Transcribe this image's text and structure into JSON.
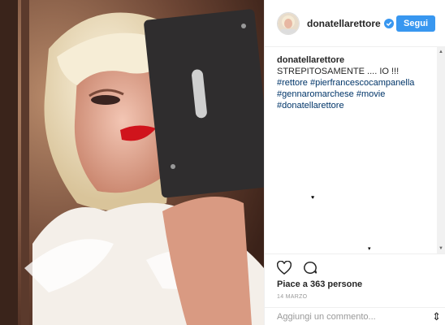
{
  "header": {
    "username": "donatellarettore",
    "follow_label": "Segui"
  },
  "caption": {
    "username": "donatellarettore",
    "text": " STREPITOSAMENTE .... IO !!! ",
    "hashtags": [
      "#rettore",
      "#pierfrancescocampanella",
      "#gennaromarchese",
      "#movie",
      "#donatellarettore"
    ]
  },
  "likes": "Piace a 363 persone",
  "date": "14 MARZO",
  "comment_box": {
    "placeholder": "Aggiungi un commento..."
  },
  "icons": {
    "like": "heart-icon",
    "comment": "comment-icon",
    "verified": "verified-badge-icon",
    "more": "more-icon"
  },
  "colors": {
    "follow_button": "#3897f0",
    "hashtag": "#003569",
    "verified": "#3897f0"
  }
}
